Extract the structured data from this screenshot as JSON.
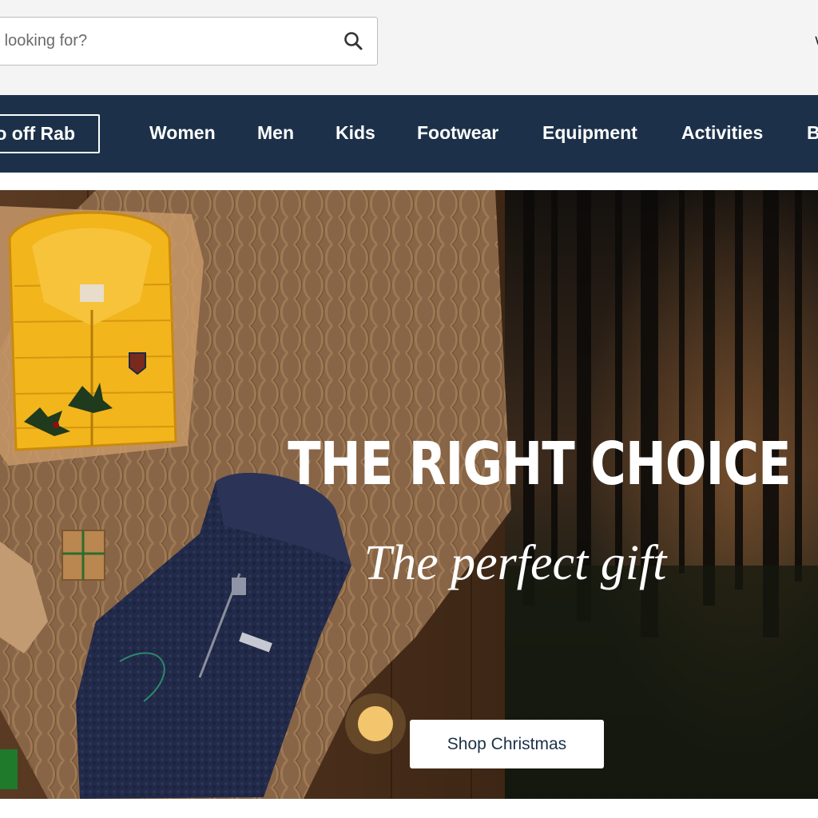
{
  "search": {
    "placeholder": "u looking for?",
    "button_icon": "search-icon"
  },
  "header": {
    "edge_icon": "partial-icon",
    "edge_glyph": "∨"
  },
  "nav": {
    "promo_label": "o off Rab",
    "items": [
      {
        "label": "Women"
      },
      {
        "label": "Men"
      },
      {
        "label": "Kids"
      },
      {
        "label": "Footwear"
      },
      {
        "label": "Equipment"
      },
      {
        "label": "Activities"
      },
      {
        "label": "B"
      }
    ]
  },
  "hero": {
    "title": "THE RIGHT CHOICE",
    "subtitle": "The perfect gift",
    "cta_label": "Shop Christmas"
  },
  "colors": {
    "nav_background": "#1c3149",
    "topbar_background": "#f4f4f4",
    "cta_text": "#1c3149",
    "jacket_yellow": "#f2b51c",
    "fleece_navy": "#222a4a"
  }
}
